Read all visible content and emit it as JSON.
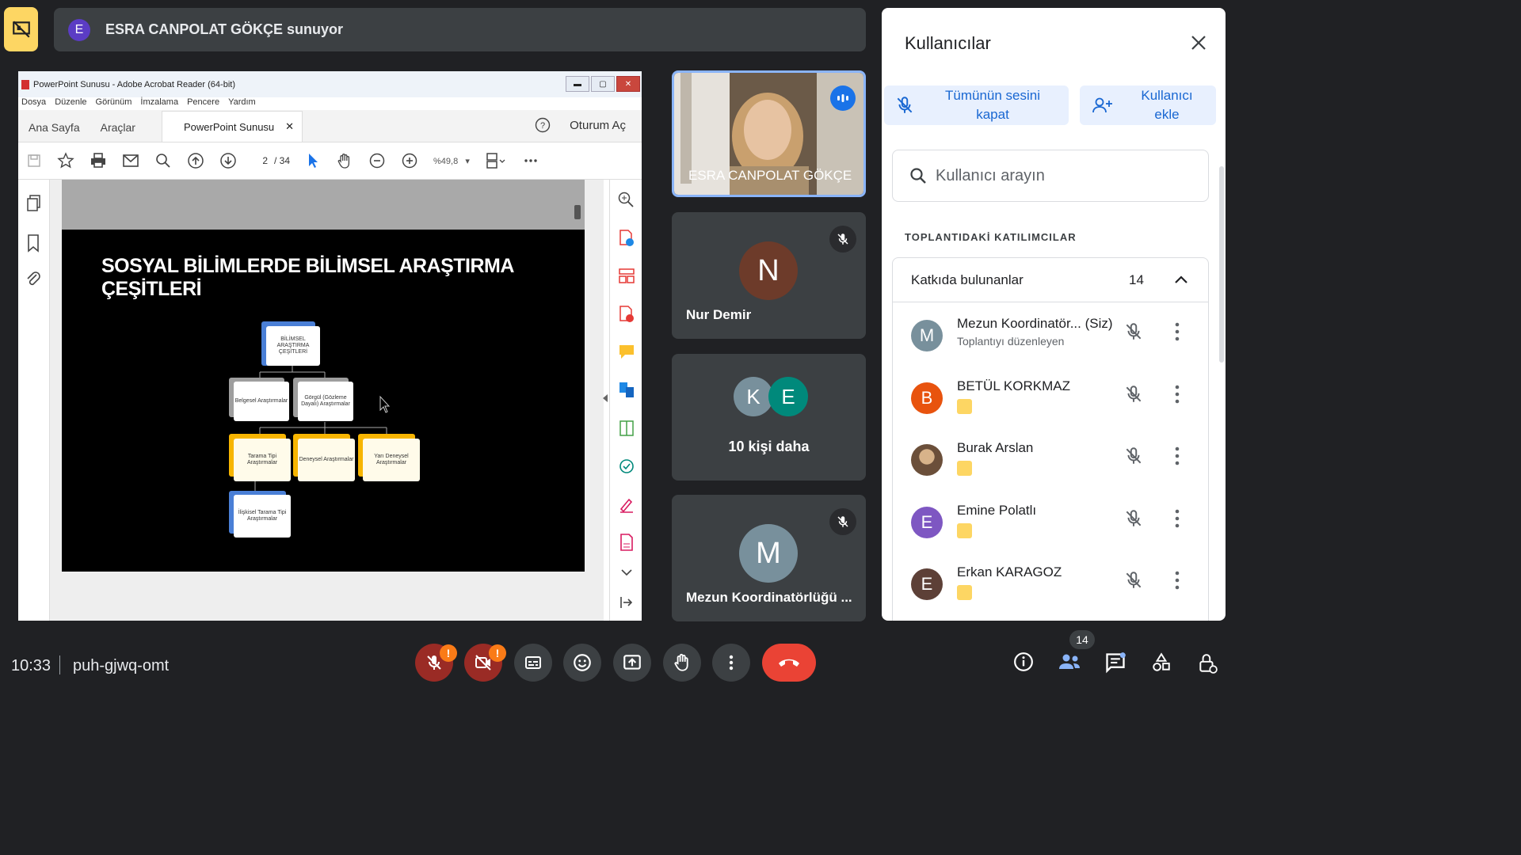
{
  "presenter_bar": {
    "avatar_letter": "E",
    "text": "ESRA CANPOLAT GÖKÇE sunuyor"
  },
  "acrobat": {
    "title": "PowerPoint Sunusu - Adobe Acrobat Reader (64-bit)",
    "menu": [
      "Dosya",
      "Düzenle",
      "Görünüm",
      "İmzalama",
      "Pencere",
      "Yardım"
    ],
    "tab_home": "Ana Sayfa",
    "tab_tools": "Araçlar",
    "doc_tab": "PowerPoint Sunusu",
    "sign_in": "Oturum Aç",
    "page_current": "2",
    "page_total": "/ 34",
    "zoom": "%49,8"
  },
  "slide": {
    "title": "SOSYAL BİLİMLERDE BİLİMSEL ARAŞTIRMA ÇEŞİTLERİ",
    "root": "BİLİMSEL ARAŞTIRMA ÇEŞİTLERİ",
    "level1": [
      "Belgesel Araştırmalar",
      "Görgül (Gözleme Dayalı) Araştırmalar"
    ],
    "level2": [
      "Tarama Tipi Araştırmalar",
      "Deneysel Araştırmalar",
      "Yarı Deneysel Araştırmalar"
    ],
    "level3": [
      "İlişkisel Tarama Tipi Araştırmalar"
    ]
  },
  "tiles": {
    "presenter_name": "ESRA CANPOLAT GÖKÇE",
    "nur_letter": "N",
    "nur_name": "Nur Demir",
    "more_letters": [
      "K",
      "E"
    ],
    "more_text": "10 kişi daha",
    "mezun_letter": "M",
    "mezun_name": "Mezun Koordinatörlüğü ..."
  },
  "panel": {
    "title": "Kullanıcılar",
    "mute_all": "Tümünün sesini kapat",
    "add_user": "Kullanıcı ekle",
    "search_placeholder": "Kullanıcı arayın",
    "section_label": "TOPLANTIDAKİ KATILIMCILAR",
    "contributors_label": "Katkıda bulunanlar",
    "contributors_count": "14",
    "participants": [
      {
        "letter": "M",
        "name": "Mezun Koordinatör... (Siz)",
        "sub": "Toplantıyı düzenleyen",
        "color": "#78909c"
      },
      {
        "letter": "B",
        "name": "BETÜL KORKMAZ",
        "sub": "",
        "color": "#e8530e"
      },
      {
        "letter": "",
        "name": "Burak Arslan",
        "sub": "",
        "color": "#8d7b68"
      },
      {
        "letter": "E",
        "name": "Emine Polatlı",
        "sub": "",
        "color": "#7e57c2"
      },
      {
        "letter": "E",
        "name": "Erkan KARAGOZ",
        "sub": "",
        "color": "#5d4037"
      }
    ]
  },
  "bottom": {
    "time": "10:33",
    "meeting_code": "puh-gjwq-omt",
    "people_count": "14",
    "warn_mark": "!"
  },
  "colors": {
    "accent_yellow": "#fdd663",
    "end_call": "#ea4335",
    "blue": "#1967d2",
    "bg": "#202124"
  }
}
